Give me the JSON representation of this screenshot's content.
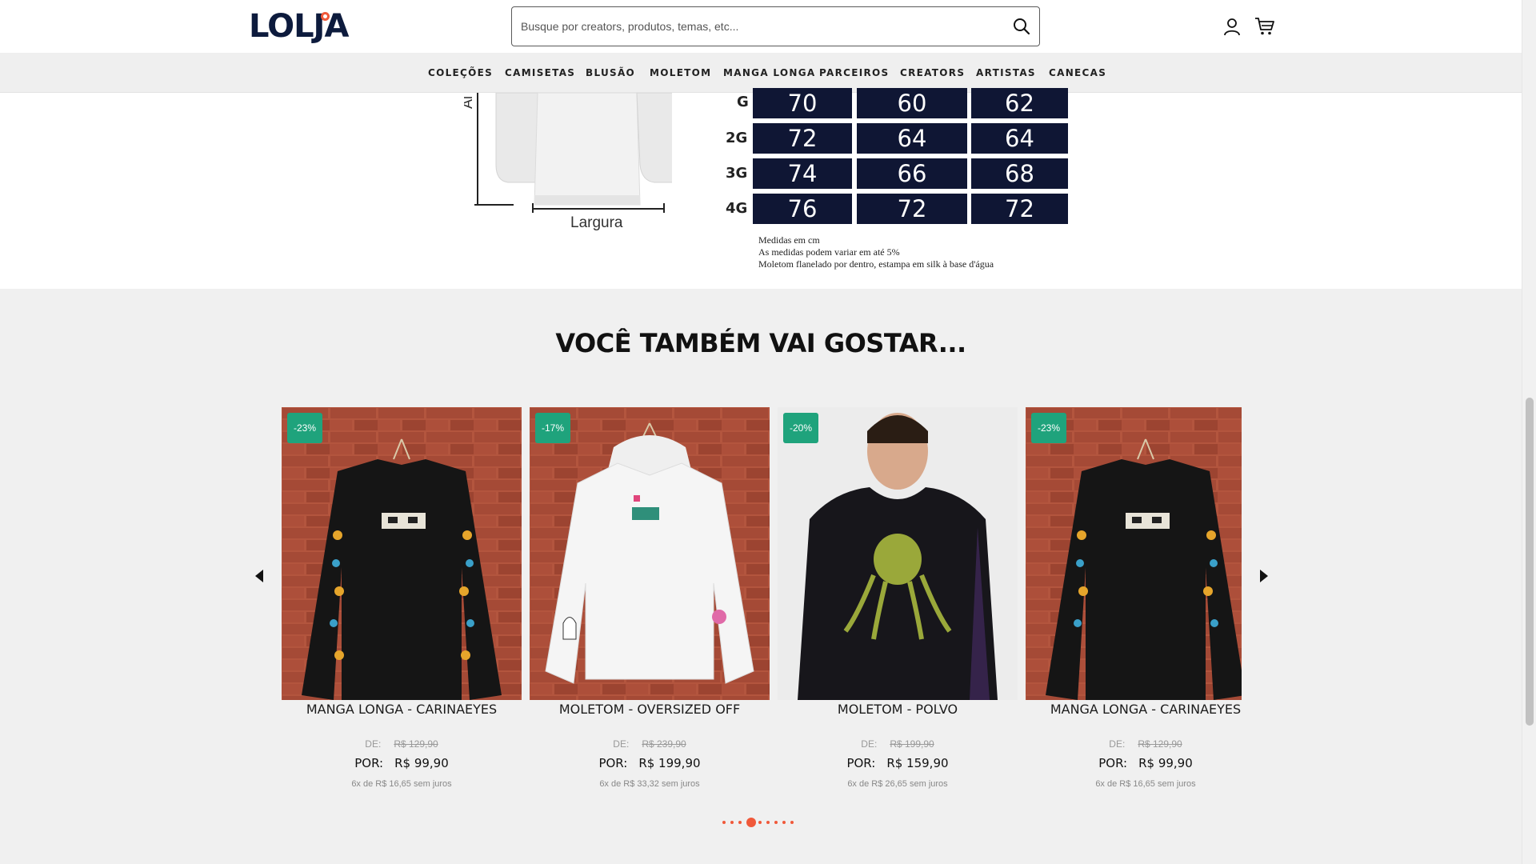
{
  "header": {
    "logo": "LOLJA",
    "search_placeholder": "Busque por creators, produtos, temas, etc..."
  },
  "nav": {
    "items": [
      "COLEÇÕES",
      "CAMISETAS",
      "BLUSÃO",
      "MOLETOM",
      "MANGA LONGA",
      "PARCEIROS",
      "CREATORS",
      "ARTISTAS",
      "CANECAS"
    ]
  },
  "size_chart": {
    "axis_label": "Largura",
    "rows": [
      {
        "size": "G",
        "values": [
          "70",
          "60",
          "62"
        ]
      },
      {
        "size": "2G",
        "values": [
          "72",
          "64",
          "64"
        ]
      },
      {
        "size": "3G",
        "values": [
          "74",
          "66",
          "68"
        ]
      },
      {
        "size": "4G",
        "values": [
          "76",
          "72",
          "72"
        ]
      }
    ],
    "notes": [
      "Medidas em cm",
      "As medidas podem variar em até 5%",
      "Moletom flanelado por dentro, estampa em silk à base d'água"
    ]
  },
  "recommendations": {
    "title": "VOCÊ TAMBÉM VAI GOSTAR...",
    "old_label": "DE:",
    "new_label": "POR:",
    "products": [
      {
        "name": "MANGA LONGA - CARINAEYES",
        "discount": "-23%",
        "old_price": "R$ 129,90",
        "new_price": "R$ 99,90",
        "installments": "6x de R$ 16,65 sem juros",
        "image": "black-longsleeve-brick"
      },
      {
        "name": "MOLETOM - OVERSIZED OFF",
        "discount": "-17%",
        "old_price": "R$ 239,90",
        "new_price": "R$ 199,90",
        "installments": "6x de R$ 33,32 sem juros",
        "image": "white-hoodie-brick"
      },
      {
        "name": "MOLETOM - POLVO",
        "discount": "-20%",
        "old_price": "R$ 199,90",
        "new_price": "R$ 159,90",
        "installments": "6x de R$ 26,65 sem juros",
        "image": "model-octopus-hoodie"
      },
      {
        "name": "MANGA LONGA - CARINAEYES",
        "discount": "-23%",
        "old_price": "R$ 129,90",
        "new_price": "R$ 99,90",
        "installments": "6x de R$ 16,65 sem juros",
        "image": "black-longsleeve-brick"
      }
    ],
    "pagination": {
      "count": 9,
      "active_index": 3
    }
  },
  "colors": {
    "accent": "#f0593a",
    "badge": "#1fa37c",
    "chart_cell": "#0f1634",
    "logo": "#0d1b3d"
  },
  "icons": [
    "search-icon",
    "user-icon",
    "cart-icon",
    "arrow-left-icon",
    "arrow-right-icon"
  ]
}
